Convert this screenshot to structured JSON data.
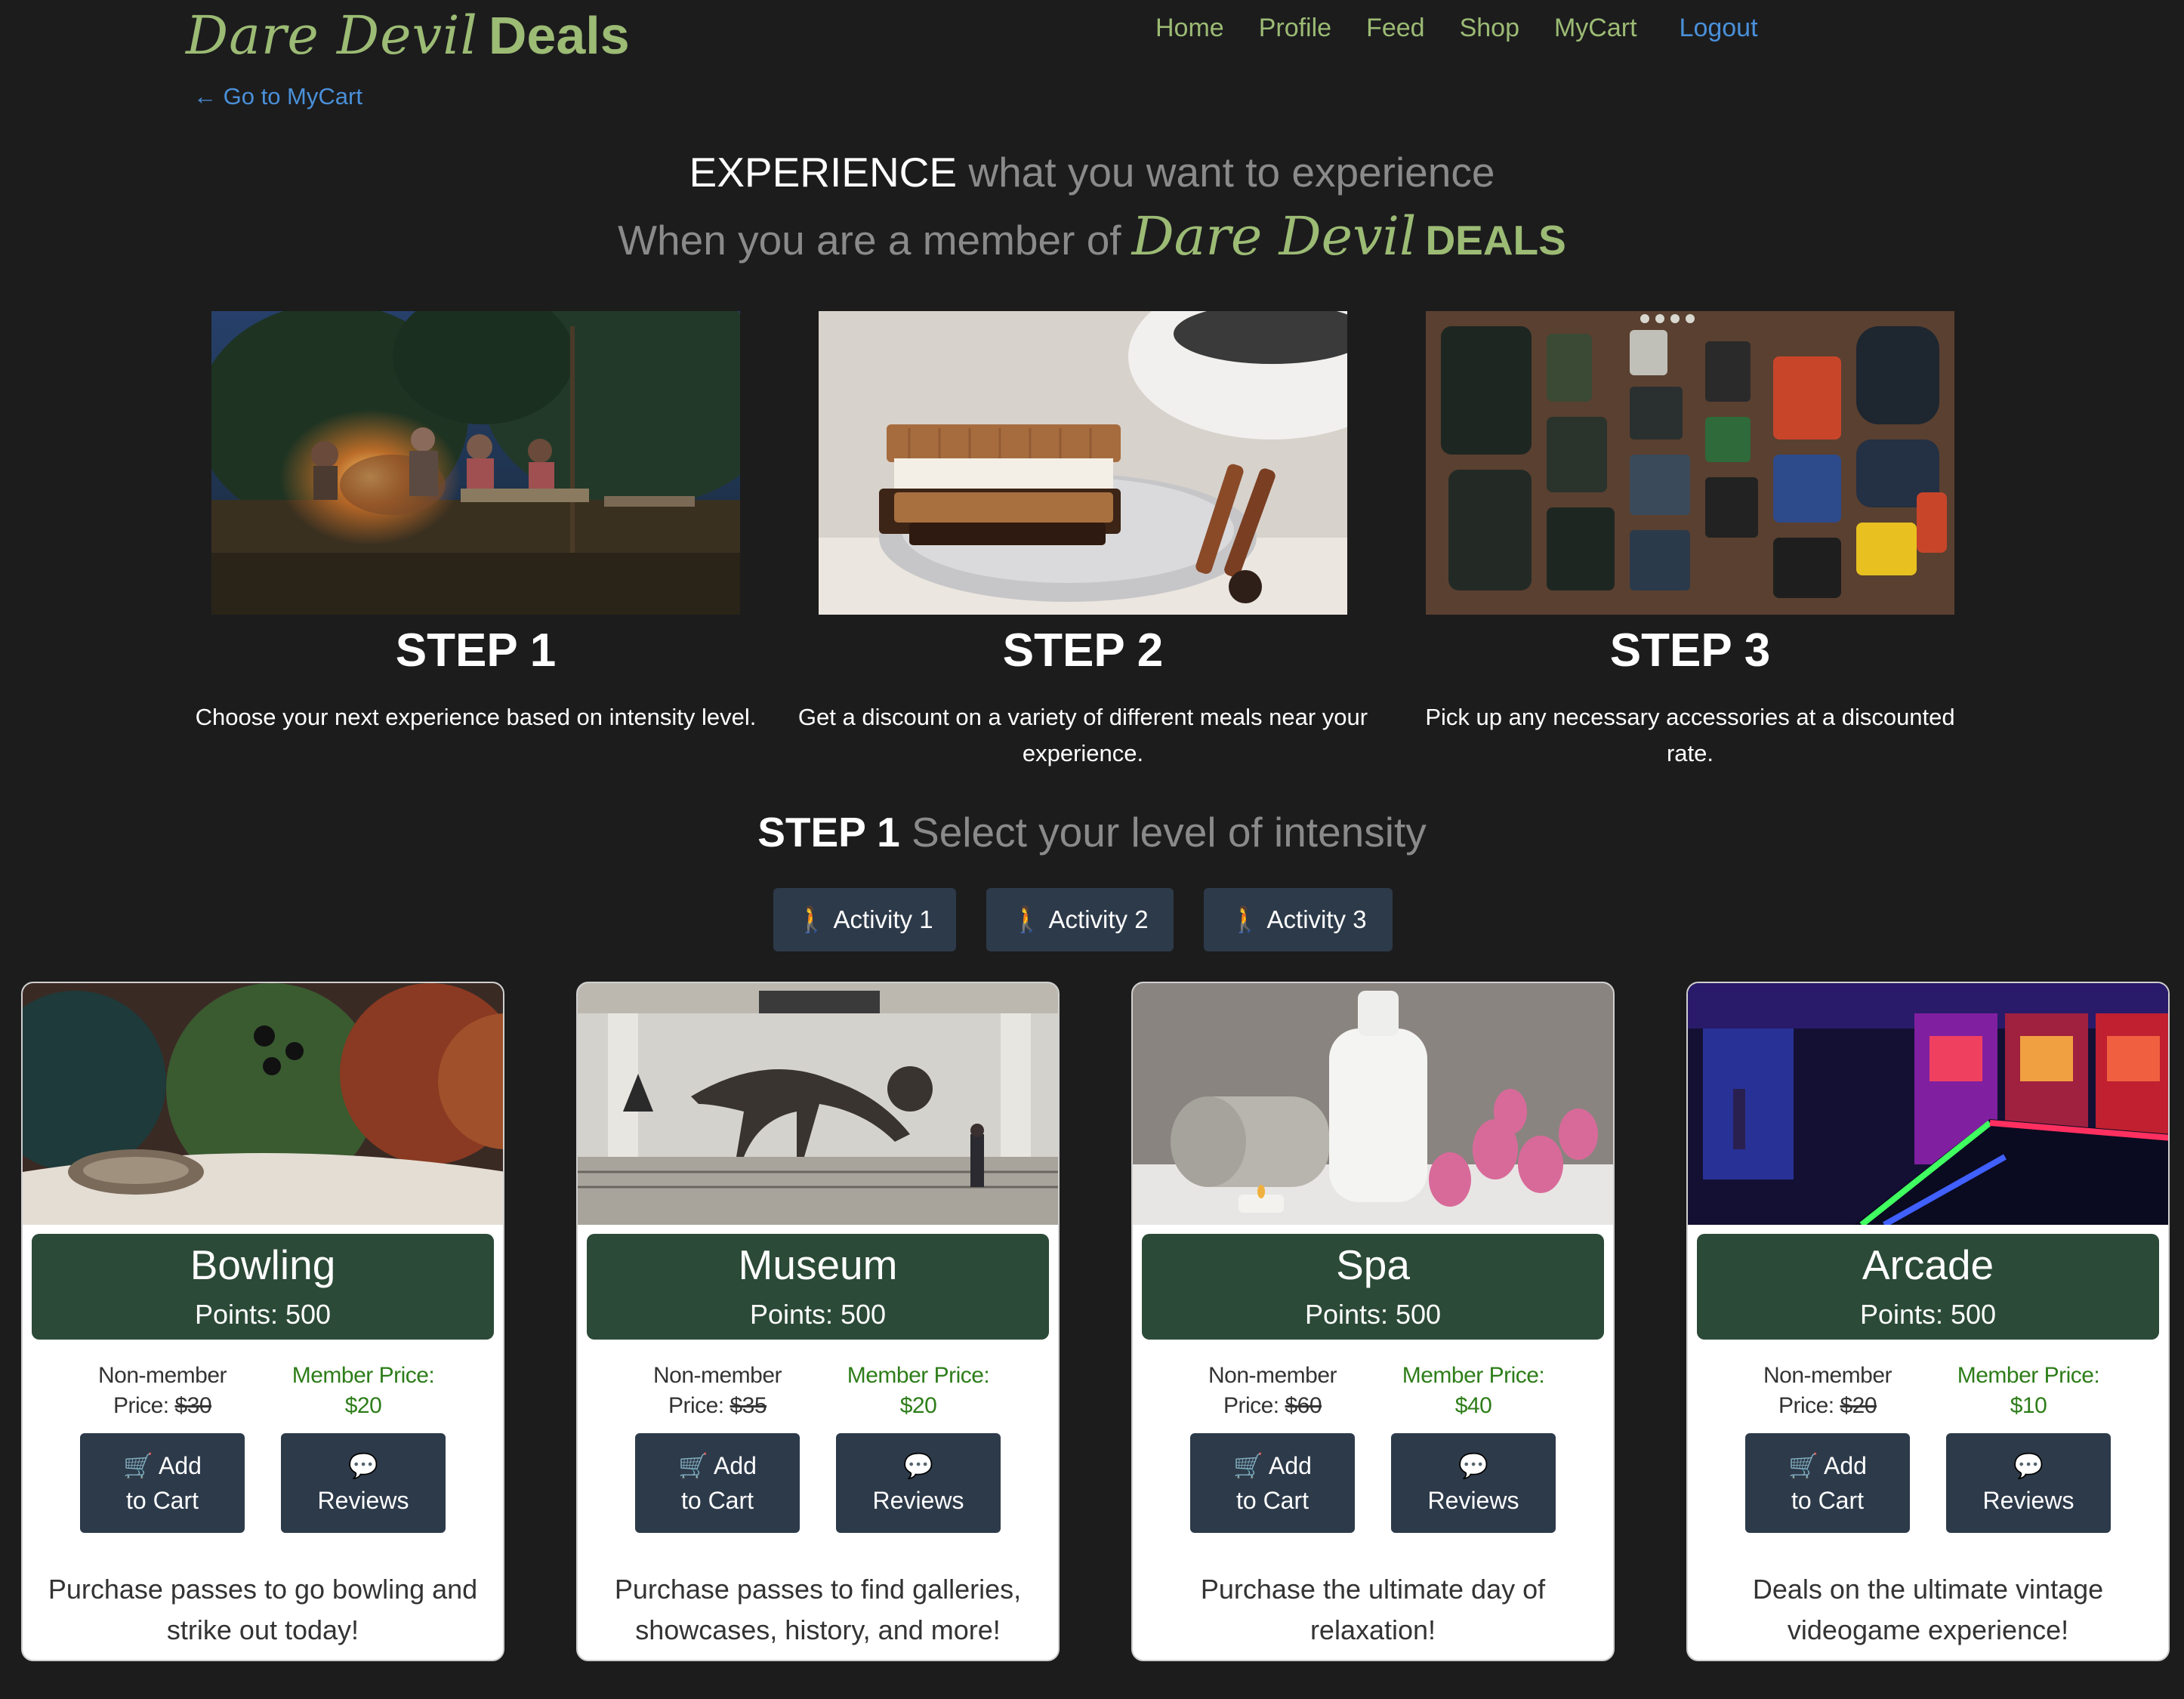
{
  "brand": {
    "script": "Dare Devil",
    "sans": "Deals"
  },
  "nav": {
    "items": [
      "Home",
      "Profile",
      "Feed",
      "Shop",
      "MyCart"
    ],
    "logout": "Logout"
  },
  "back_link": {
    "arrow": "←",
    "label": "Go to MyCart"
  },
  "hero": {
    "line1_strong": "EXPERIENCE",
    "line1_muted": "what you want to experience",
    "line2_muted": "When you are a member of",
    "line2_script": "Dare Devil",
    "line2_sans": "DEALS"
  },
  "steps": [
    {
      "title": "STEP 1",
      "desc": "Choose your next experience based on intensity level."
    },
    {
      "title": "STEP 2",
      "desc": "Get a discount on a variety of different meals near your experience."
    },
    {
      "title": "STEP 3",
      "desc": "Pick up any necessary accessories at a discounted rate."
    }
  ],
  "intensity": {
    "title_strong": "STEP 1",
    "title_muted": "Select your level of intensity",
    "activities": [
      "Activity 1",
      "Activity 2",
      "Activity 3"
    ]
  },
  "cards": [
    {
      "name": "Bowling",
      "points": "Points: 500",
      "non_label_1": "Non-member",
      "non_label_2": "Price:",
      "non_price": "$30",
      "mem_label": "Member Price:",
      "mem_price": "$20",
      "add_1": "Add",
      "add_2": "to Cart",
      "reviews": "Reviews",
      "desc": "Purchase passes to go bowling and strike out today!"
    },
    {
      "name": "Museum",
      "points": "Points: 500",
      "non_label_1": "Non-member",
      "non_label_2": "Price:",
      "non_price": "$35",
      "mem_label": "Member Price:",
      "mem_price": "$20",
      "add_1": "Add",
      "add_2": "to Cart",
      "reviews": "Reviews",
      "desc": "Purchase passes to find galleries, showcases, history, and more!"
    },
    {
      "name": "Spa",
      "points": "Points: 500",
      "non_label_1": "Non-member",
      "non_label_2": "Price:",
      "non_price": "$60",
      "mem_label": "Member Price:",
      "mem_price": "$40",
      "add_1": "Add",
      "add_2": "to Cart",
      "reviews": "Reviews",
      "desc": "Purchase the ultimate day of relaxation!"
    },
    {
      "name": "Arcade",
      "points": "Points: 500",
      "non_label_1": "Non-member",
      "non_label_2": "Price:",
      "non_price": "$20",
      "mem_label": "Member Price:",
      "mem_price": "$10",
      "add_1": "Add",
      "add_2": "to Cart",
      "reviews": "Reviews",
      "desc": "Deals on the ultimate vintage videogame experience!"
    }
  ],
  "icons": {
    "activity": "hiking-icon",
    "cart": "shopping-cart-icon",
    "reviews": "comments-icon",
    "back": "arrow-left-icon"
  },
  "colors": {
    "background": "#1c1c1d",
    "brand_green": "#9cbb74",
    "link_blue": "#4a90d9",
    "button_navy": "#2d3a4a",
    "card_header_green": "#2b4a37",
    "member_price_green": "#2e7d1a"
  }
}
